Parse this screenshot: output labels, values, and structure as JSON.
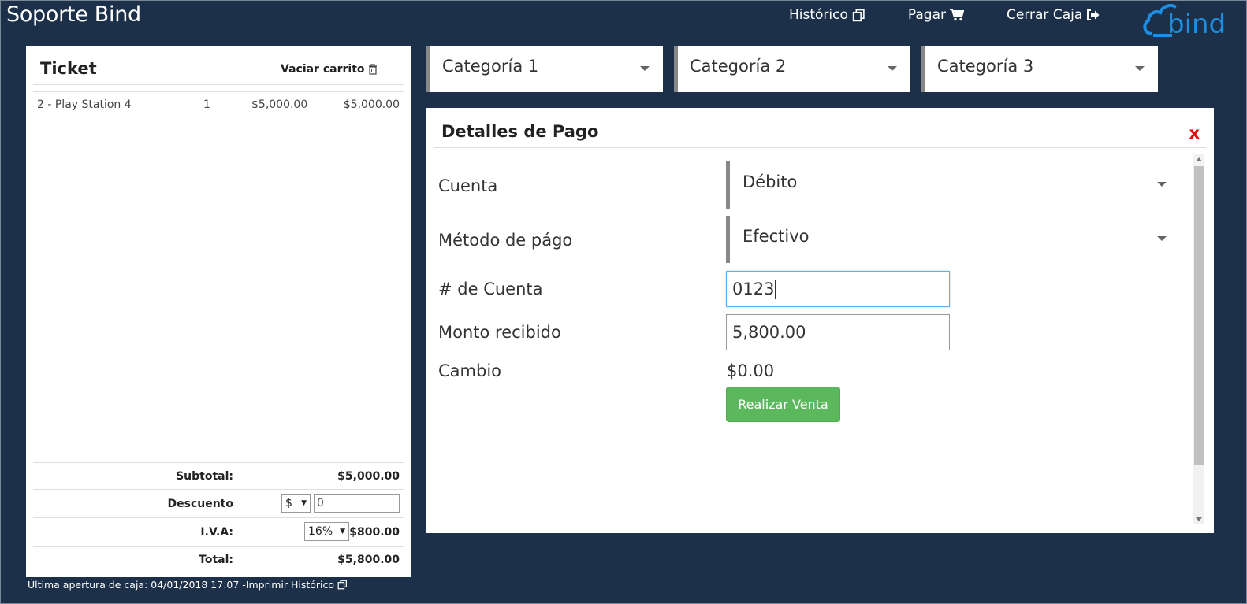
{
  "header": {
    "app_title": "Soporte Bind",
    "nav": {
      "historico": "Histórico",
      "pagar": "Pagar",
      "cerrar_caja": "Cerrar Caja"
    },
    "logo_text": "bind"
  },
  "ticket": {
    "title": "Ticket",
    "empty_cart": "Vaciar carrito",
    "items": [
      {
        "name": "2 - Play Station 4",
        "qty": "1",
        "price": "$5,000.00",
        "total": "$5,000.00"
      }
    ],
    "subtotal_label": "Subtotal:",
    "subtotal_value": "$5,000.00",
    "discount_label": "Descuento",
    "discount_type": "$",
    "discount_value": "0",
    "iva_label": "I.V.A:",
    "iva_rate": "16%",
    "iva_value": "$800.00",
    "total_label": "Total:",
    "total_value": "$5,800.00"
  },
  "footer": {
    "last_open": "Última apertura de caja: 04/01/2018 17:07 - ",
    "print_history": "Imprimir Histórico"
  },
  "categories": [
    "Categoría 1",
    "Categoría 2",
    "Categoría 3"
  ],
  "payment": {
    "title": "Detalles de Pago",
    "close": "x",
    "account_label": "Cuenta",
    "account_value": "Débito",
    "method_label": "Método de págo",
    "method_value": "Efectivo",
    "account_number_label": "# de Cuenta",
    "account_number_value": "0123",
    "amount_label": "Monto recibido",
    "amount_value": "5,800.00",
    "change_label": "Cambio",
    "change_value": "$0.00",
    "submit_label": "Realizar Venta"
  },
  "colors": {
    "background": "#1c304a",
    "success": "#5cb85c",
    "close": "#ee0000",
    "logo_blue": "#1e8fe0"
  }
}
